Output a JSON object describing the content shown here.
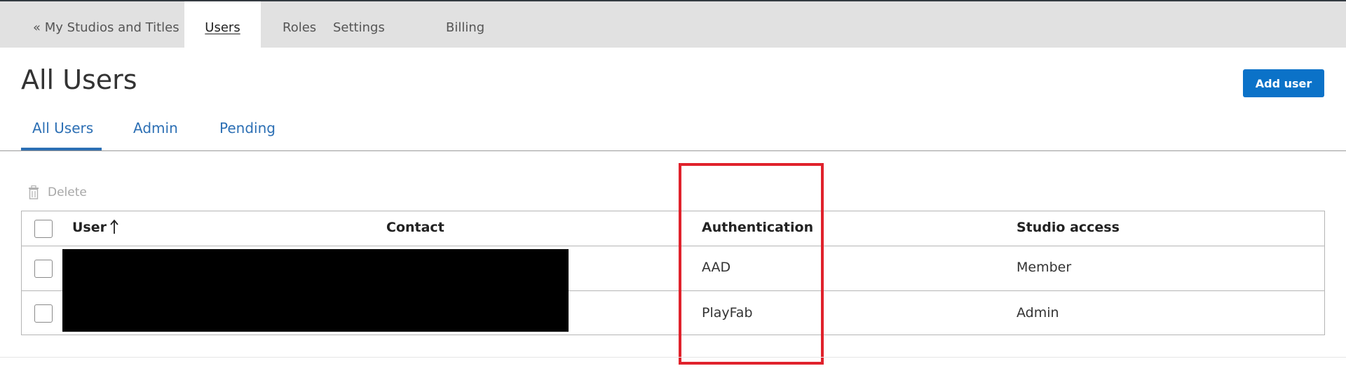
{
  "topnav": {
    "back_label": "« My Studios and Titles",
    "tabs": [
      {
        "label": "Users",
        "active": true
      },
      {
        "label": "Roles",
        "active": false
      },
      {
        "label": "Settings",
        "active": false
      },
      {
        "label": "Billing",
        "active": false
      }
    ]
  },
  "page": {
    "title": "All Users",
    "add_user_label": "Add user"
  },
  "subtabs": [
    {
      "label": "All Users",
      "active": true
    },
    {
      "label": "Admin",
      "active": false
    },
    {
      "label": "Pending",
      "active": false
    }
  ],
  "actions": {
    "delete_label": "Delete",
    "delete_enabled": false,
    "delete_icon": "trash-icon"
  },
  "table": {
    "columns": [
      "User",
      "Contact",
      "Authentication",
      "Studio access"
    ],
    "sort": {
      "column": "User",
      "direction": "ascending",
      "icon": "arrow-up-icon"
    },
    "rows": [
      {
        "user": "",
        "contact": "",
        "authentication": "AAD",
        "studio_access": "Member"
      },
      {
        "user": "",
        "contact": "",
        "authentication": "PlayFab",
        "studio_access": "Admin"
      }
    ]
  },
  "colors": {
    "accent": "#2c6fb4",
    "primary_button": "#0b72c8",
    "highlight": "#e0222c",
    "nav_bg": "#e1e1e1"
  }
}
